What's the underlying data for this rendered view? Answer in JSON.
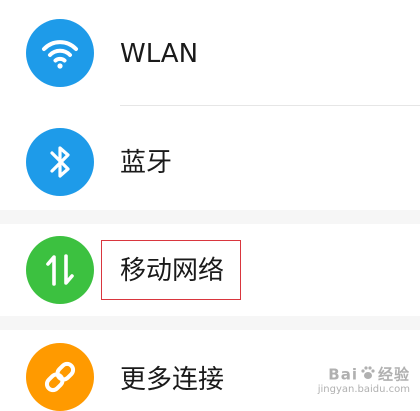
{
  "settings": {
    "items": [
      {
        "label": "WLAN",
        "icon": "wifi-icon",
        "color": "#1E9BE9"
      },
      {
        "label": "蓝牙",
        "icon": "bluetooth-icon",
        "color": "#1E9BE9"
      },
      {
        "label": "移动网络",
        "icon": "mobile-data-icon",
        "color": "#3CC140"
      },
      {
        "label": "更多连接",
        "icon": "link-icon",
        "color": "#FF9A00"
      }
    ]
  },
  "watermark": {
    "brand": "Bai",
    "brand_tail": "经验",
    "url": "jingyan.baidu.com"
  }
}
